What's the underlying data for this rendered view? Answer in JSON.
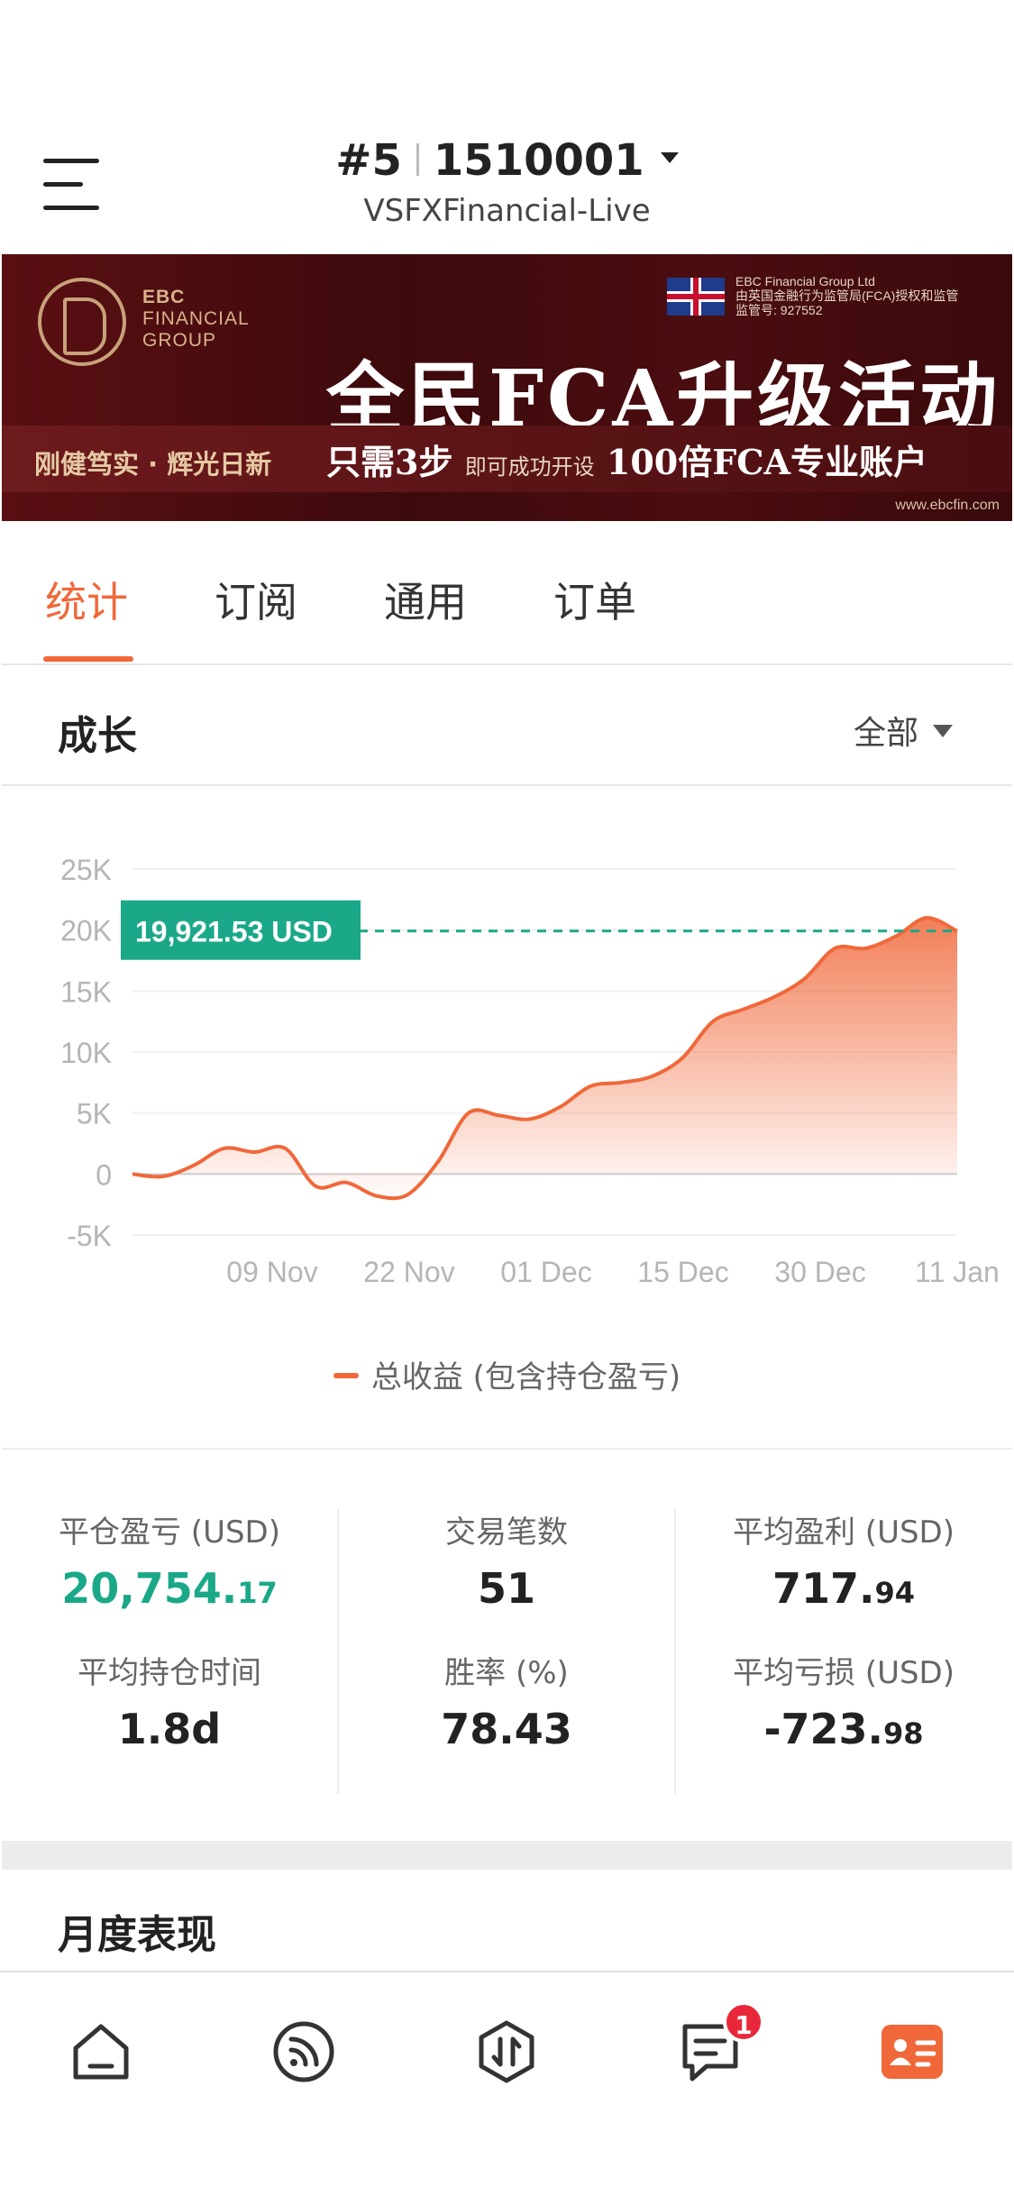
{
  "header": {
    "account_number": "#5",
    "account_id": "1510001",
    "server": "VSFXFinancial-Live"
  },
  "banner": {
    "logo_line1": "EBC",
    "logo_line2": "FINANCIAL",
    "logo_line3": "GROUP",
    "regulator_line1": "EBC Financial Group Ltd",
    "regulator_line2": "由英国金融行为监管局(FCA)授权和监管",
    "regulator_line3": "监管号: 927552",
    "headline": "全民FCA升级活动",
    "slogan": "刚健笃实 · 辉光日新",
    "subline_part1": "只需3步",
    "subline_part2": "即可成功开设",
    "subline_part3": "100倍FCA专业账户",
    "url": "www.ebcfin.com"
  },
  "tabs": [
    {
      "label": "统计",
      "active": true
    },
    {
      "label": "订阅",
      "active": false
    },
    {
      "label": "通用",
      "active": false
    },
    {
      "label": "订单",
      "active": false
    }
  ],
  "growth": {
    "title": "成长",
    "filter_label": "全部"
  },
  "chart_data": {
    "type": "area",
    "y_ticks": [
      "25K",
      "20K",
      "15K",
      "10K",
      "5K",
      "0",
      "-5K"
    ],
    "ylim": [
      -5000,
      25000
    ],
    "x_ticks": [
      "09 Nov",
      "22 Nov",
      "01 Dec",
      "15 Dec",
      "30 Dec",
      "11 Jan"
    ],
    "current_value_label": "19,921.53 USD",
    "current_value": 19921.53,
    "series": [
      {
        "name": "总收益 (包含持仓盈亏)",
        "color": "#f0683a",
        "x": [
          "29 Oct",
          "01 Nov",
          "04 Nov",
          "07 Nov",
          "09 Nov",
          "12 Nov",
          "15 Nov",
          "18 Nov",
          "20 Nov",
          "22 Nov",
          "24 Nov",
          "27 Nov",
          "29 Nov",
          "01 Dec",
          "04 Dec",
          "07 Dec",
          "10 Dec",
          "13 Dec",
          "15 Dec",
          "18 Dec",
          "21 Dec",
          "24 Dec",
          "27 Dec",
          "30 Dec",
          "02 Jan",
          "05 Jan",
          "08 Jan",
          "11 Jan"
        ],
        "values": [
          0,
          -200,
          700,
          2100,
          1800,
          2100,
          -1000,
          -700,
          -1800,
          -1700,
          1000,
          5000,
          4800,
          4500,
          5500,
          7200,
          7500,
          8000,
          9500,
          12500,
          13500,
          14500,
          16000,
          18500,
          18500,
          19500,
          21000,
          19900
        ]
      }
    ]
  },
  "stats": {
    "closed_pnl_label": "平仓盈亏 (USD)",
    "closed_pnl_int": "20,754.",
    "closed_pnl_dec": "17",
    "trades_label": "交易笔数",
    "trades_value": "51",
    "avg_profit_label": "平均盈利 (USD)",
    "avg_profit_int": "717.",
    "avg_profit_dec": "94",
    "avg_hold_label": "平均持仓时间",
    "avg_hold_value": "1.8d",
    "win_rate_label": "胜率 (%)",
    "win_rate_value": "78.43",
    "avg_loss_label": "平均亏损 (USD)",
    "avg_loss_int": "-723.",
    "avg_loss_dec": "98"
  },
  "monthly": {
    "title": "月度表现"
  },
  "bottom_nav": {
    "items": [
      "home-icon",
      "signal-feed-icon",
      "trade-exchange-icon",
      "messages-icon",
      "account-card-icon"
    ],
    "messages_badge": "1",
    "active_color": "#f0683a"
  }
}
